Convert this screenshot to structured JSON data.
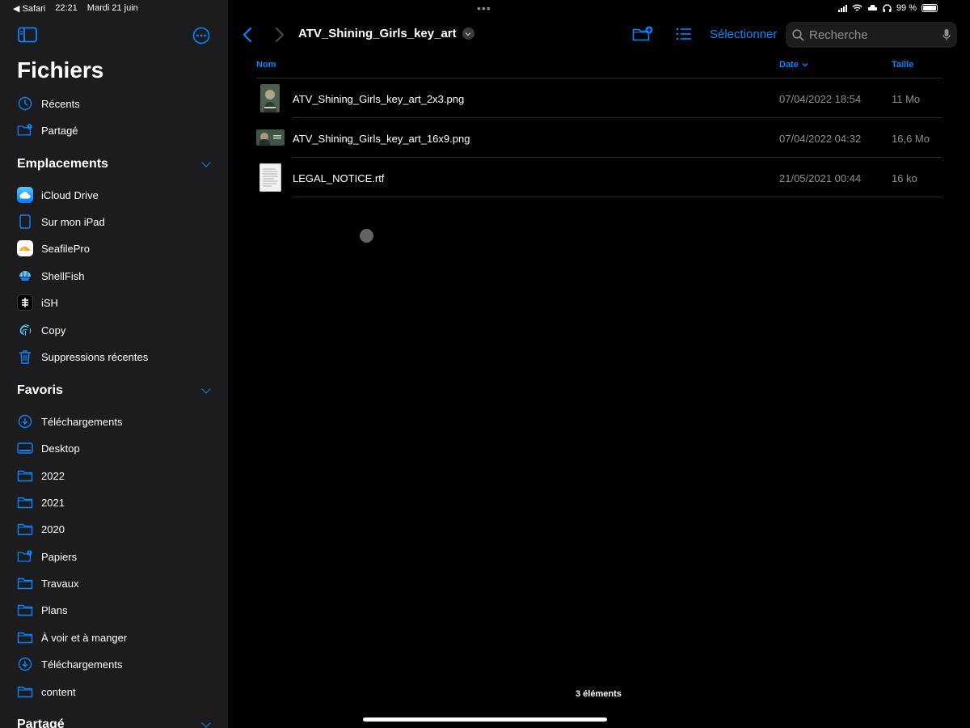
{
  "status": {
    "back_app": "◀ Safari",
    "time": "22:21",
    "date": "Mardi 21 juin",
    "battery": "99 %",
    "dots": "•••"
  },
  "sidebar": {
    "title": "Fichiers",
    "top_items": [
      {
        "label": "Récents",
        "icon": "clock-icon"
      },
      {
        "label": "Partagé",
        "icon": "shared-folder-icon"
      }
    ],
    "locations": {
      "title": "Emplacements",
      "items": [
        {
          "label": "iCloud Drive",
          "icon": "icloud-icon"
        },
        {
          "label": "Sur mon iPad",
          "icon": "ipad-icon"
        },
        {
          "label": "SeafilePro",
          "icon": "seafile-icon"
        },
        {
          "label": "ShellFish",
          "icon": "shellfish-icon"
        },
        {
          "label": "iSH",
          "icon": "ish-icon"
        },
        {
          "label": "Copy",
          "icon": "fingerprint-icon"
        },
        {
          "label": "Suppressions récentes",
          "icon": "trash-icon"
        }
      ]
    },
    "favorites": {
      "title": "Favoris",
      "items": [
        {
          "label": "Téléchargements",
          "icon": "download-circle-icon"
        },
        {
          "label": "Desktop",
          "icon": "desktop-icon"
        },
        {
          "label": "2022",
          "icon": "folder-icon"
        },
        {
          "label": "2021",
          "icon": "folder-icon"
        },
        {
          "label": "2020",
          "icon": "folder-icon"
        },
        {
          "label": "Papiers",
          "icon": "shared-folder-icon"
        },
        {
          "label": "Travaux",
          "icon": "folder-icon"
        },
        {
          "label": "Plans",
          "icon": "folder-icon"
        },
        {
          "label": "À voir et à manger",
          "icon": "folder-icon"
        },
        {
          "label": "Téléchargements",
          "icon": "download-circle-icon"
        },
        {
          "label": "content",
          "icon": "folder-icon"
        }
      ]
    },
    "shared_section": {
      "title": "Partagé"
    }
  },
  "toolbar": {
    "folder_title": "ATV_Shining_Girls_key_art",
    "select_label": "Sélectionner",
    "search_placeholder": "Recherche"
  },
  "columns": {
    "name": "Nom",
    "date": "Date",
    "size": "Taille"
  },
  "files": [
    {
      "name": "ATV_Shining_Girls_key_art_2x3.png",
      "date": "07/04/2022 18:54",
      "size": "11 Mo",
      "kind": "portrait-image"
    },
    {
      "name": "ATV_Shining_Girls_key_art_16x9.png",
      "date": "07/04/2022 04:32",
      "size": "16,6 Mo",
      "kind": "landscape-image"
    },
    {
      "name": "LEGAL_NOTICE.rtf",
      "date": "21/05/2021 00:44",
      "size": "16 ko",
      "kind": "document"
    }
  ],
  "footer": {
    "count": "3 éléments"
  },
  "colors": {
    "accent": "#0a84ff",
    "sidebar_bg": "#1c1c1e",
    "main_bg": "#000000"
  }
}
